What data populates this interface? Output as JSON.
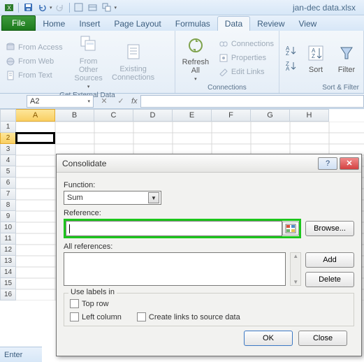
{
  "title": {
    "filename": "jan-dec data.xlsx"
  },
  "qat": {
    "save": "save-icon",
    "undo": "undo-icon",
    "redo": "redo-icon"
  },
  "tabs": {
    "file": "File",
    "items": [
      "Home",
      "Insert",
      "Page Layout",
      "Formulas",
      "Data",
      "Review",
      "View"
    ],
    "active": "Data"
  },
  "ribbon": {
    "ext": {
      "access": "From Access",
      "web": "From Web",
      "text": "From Text",
      "other": "From Other Sources",
      "existing": "Existing Connections",
      "group": "Get External Data"
    },
    "conn": {
      "refresh": "Refresh All",
      "connections": "Connections",
      "properties": "Properties",
      "editlinks": "Edit Links",
      "group": "Connections"
    },
    "sortfilter": {
      "sort": "Sort",
      "filter": "Filter",
      "group": "Sort & Filter"
    }
  },
  "namebox": {
    "value": "A2",
    "fx": "fx"
  },
  "columns": [
    "A",
    "B",
    "C",
    "D",
    "E",
    "F",
    "G",
    "H"
  ],
  "rows": [
    "1",
    "2",
    "3",
    "4",
    "5",
    "6",
    "7",
    "8",
    "9",
    "10",
    "11",
    "12",
    "13",
    "14",
    "15",
    "16"
  ],
  "selected_column": "A",
  "selected_row": "2",
  "status": {
    "mode": "Enter"
  },
  "dialog": {
    "title": "Consolidate",
    "function_label": "Function:",
    "function_value": "Sum",
    "reference_label": "Reference:",
    "reference_value": "",
    "allrefs_label": "All references:",
    "browse": "Browse...",
    "add": "Add",
    "delete": "Delete",
    "group_legend": "Use labels in",
    "top_row": "Top row",
    "left_col": "Left column",
    "create_links": "Create links to source data",
    "ok": "OK",
    "close": "Close"
  }
}
